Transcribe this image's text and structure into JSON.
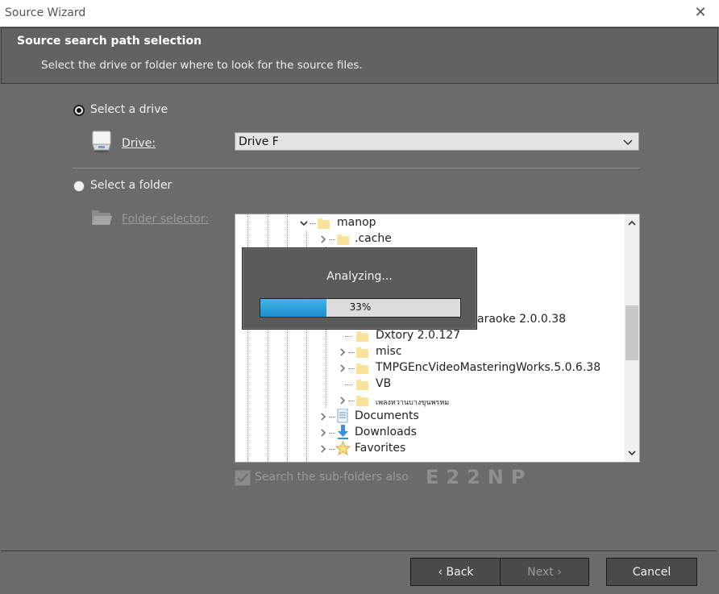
{
  "window": {
    "title": "Source Wizard",
    "close_glyph": "✕"
  },
  "header": {
    "title": "Source search path selection",
    "subtitle": "Select the drive or folder where to look for the source files."
  },
  "drive_option": {
    "label": "Select a drive",
    "checked": true,
    "field_label": "Drive:",
    "selected_value": "Drive F",
    "icon": "drive-icon"
  },
  "folder_option": {
    "label": "Select a folder",
    "checked": false,
    "field_label": "Folder selector:",
    "icon": "folder-icon"
  },
  "tree": {
    "items": [
      {
        "label": "manop",
        "expanded": true
      },
      {
        "label": ".cache",
        "expanded": false
      },
      {
        "label": "araoke 2.0.0.38"
      },
      {
        "label": "Dxtory 2.0.127"
      },
      {
        "label": "misc",
        "expanded": false
      },
      {
        "label": "TMPGEncVideoMasteringWorks.5.0.6.38",
        "expanded": false
      },
      {
        "label": "VB"
      },
      {
        "label": "เพลงหวานบางขุนพรหม",
        "expanded": false
      },
      {
        "label": "Documents",
        "expanded": false
      },
      {
        "label": "Downloads",
        "expanded": false
      },
      {
        "label": "Favorites",
        "expanded": false
      }
    ]
  },
  "analyzing": {
    "message": "Analyzing...",
    "progress_percent": 33,
    "progress_text": "33%"
  },
  "subfolders_checkbox": {
    "label": "Search the sub-folders also",
    "checked": true
  },
  "watermark": "E22NP",
  "buttons": {
    "back": "‹ Back",
    "next": "Next ›",
    "cancel": "Cancel"
  },
  "colors": {
    "background": "#6b6b6b",
    "header": "#626262",
    "progress_fill": "#2ea3dd",
    "folder": "#fde7a0"
  }
}
